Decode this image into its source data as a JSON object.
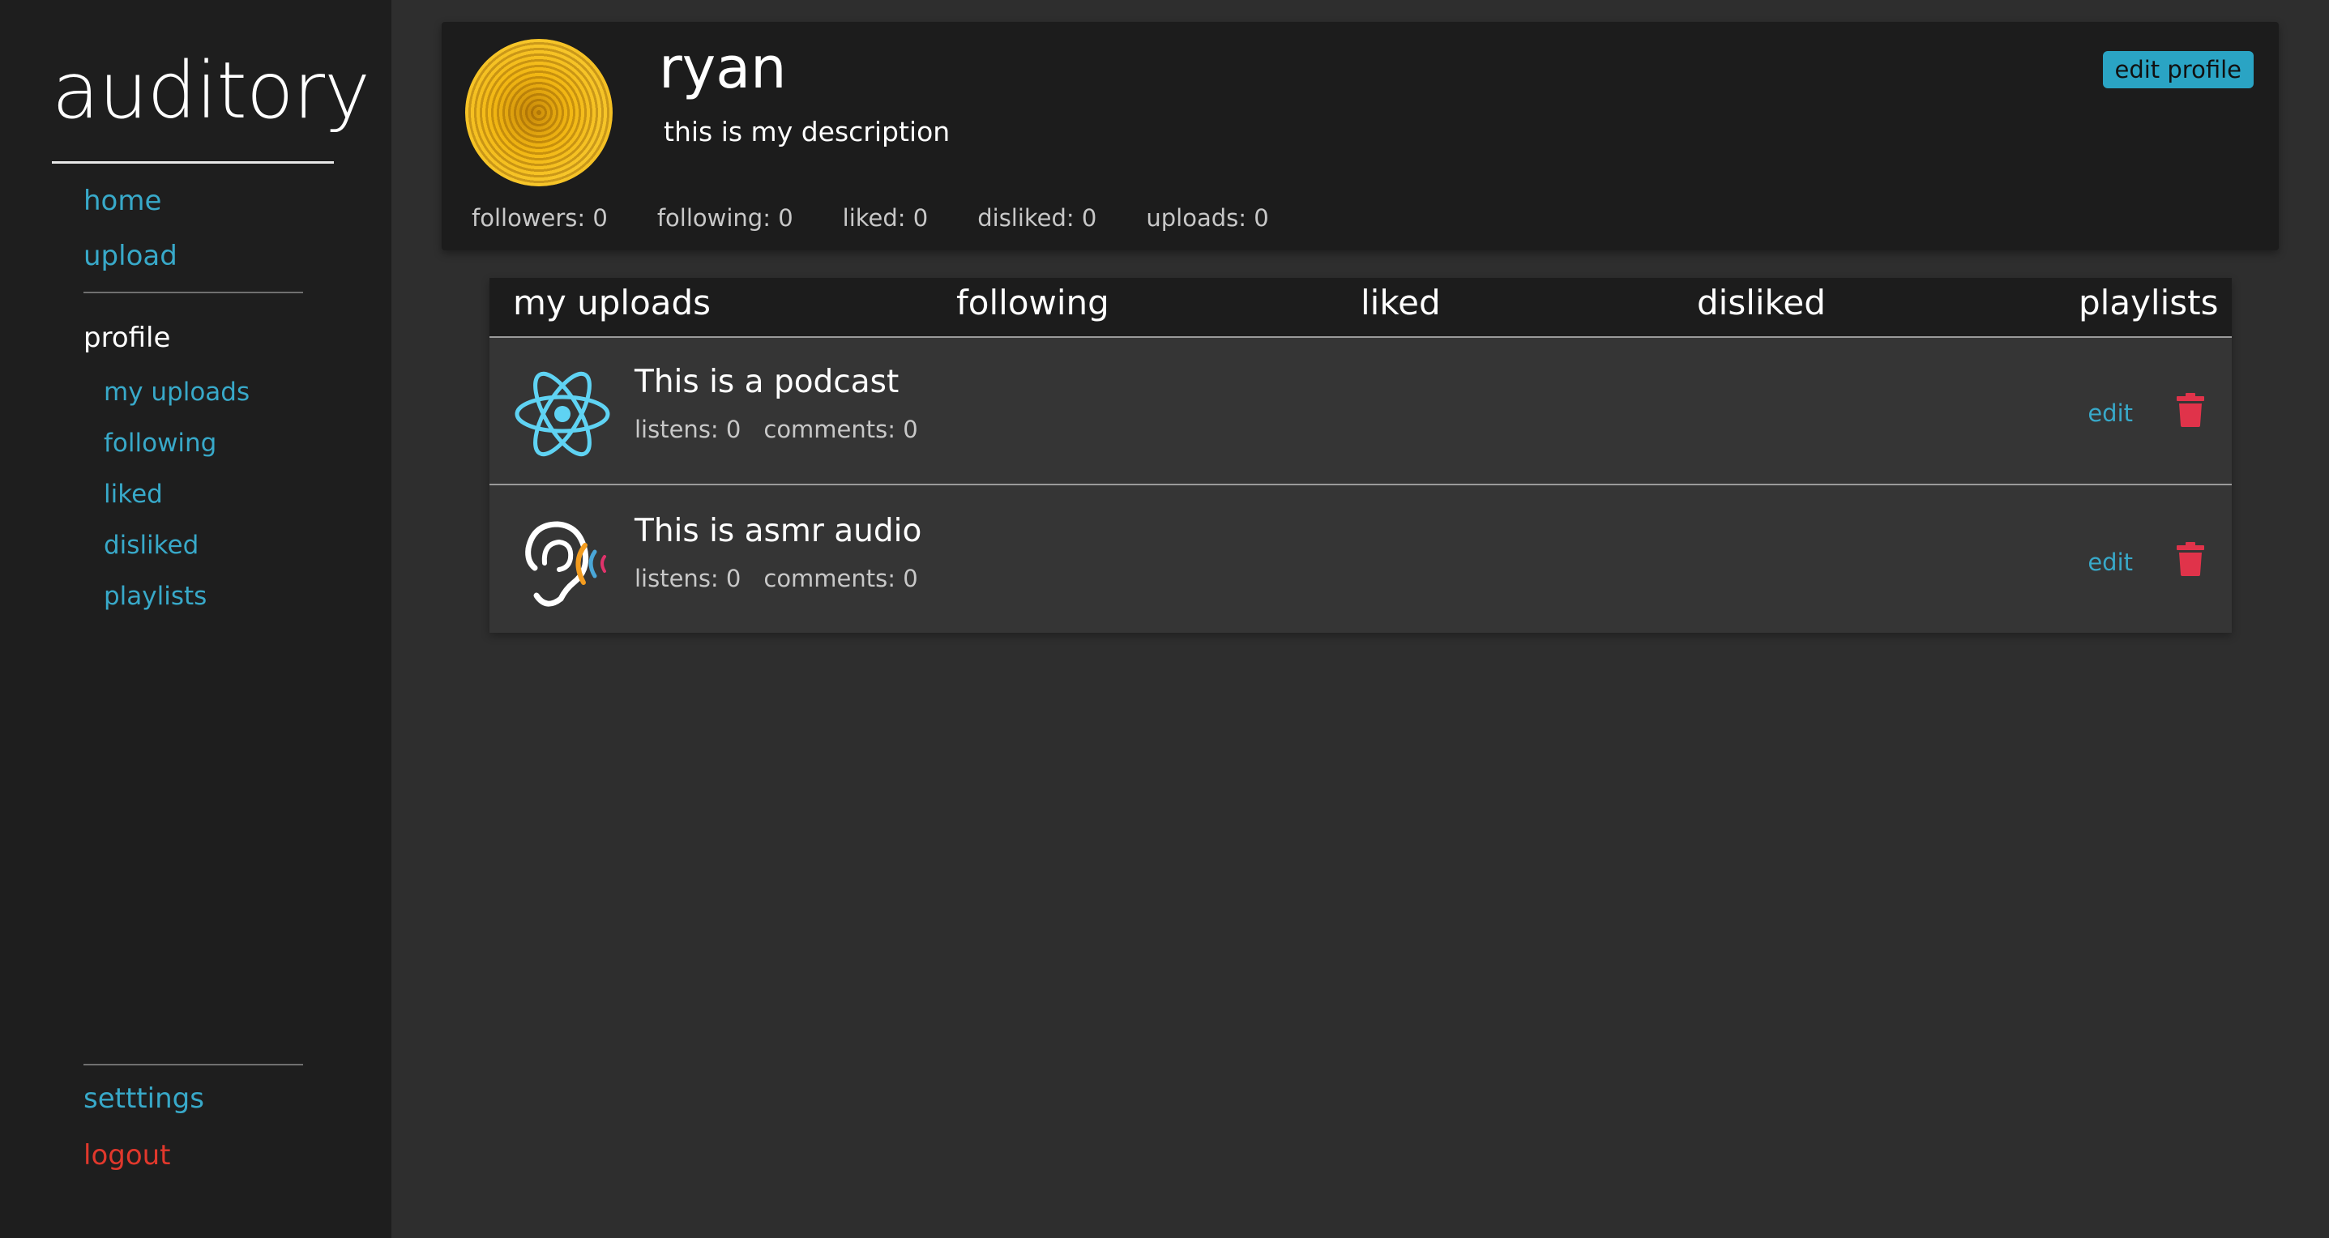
{
  "sidebar": {
    "logo": "auditory",
    "primary": [
      {
        "label": "home"
      },
      {
        "label": "upload"
      }
    ],
    "profile_heading": "profile",
    "profile_items": [
      {
        "label": "my uploads"
      },
      {
        "label": "following"
      },
      {
        "label": "liked"
      },
      {
        "label": "disliked"
      },
      {
        "label": "playlists"
      }
    ],
    "settings_label": "setttings",
    "logout_label": "logout"
  },
  "profile": {
    "username": "ryan",
    "description": "this is my description",
    "edit_label": "edit profile",
    "stats": {
      "followers": "followers: 0",
      "following": "following: 0",
      "liked": "liked: 0",
      "disliked": "disliked: 0",
      "uploads": "uploads: 0"
    }
  },
  "tabs": [
    "my uploads",
    "following",
    "liked",
    "disliked",
    "playlists"
  ],
  "uploads": [
    {
      "title": "This is a podcast",
      "listens": "listens: 0",
      "comments": "comments: 0",
      "edit_label": "edit",
      "icon": "react-atom-icon"
    },
    {
      "title": "This is asmr audio",
      "listens": "listens: 0",
      "comments": "comments: 0",
      "edit_label": "edit",
      "icon": "ear-sound-icon"
    }
  ],
  "colors": {
    "accent": "#38a9c9",
    "danger": "#e0382c",
    "trash": "#e0334a"
  }
}
